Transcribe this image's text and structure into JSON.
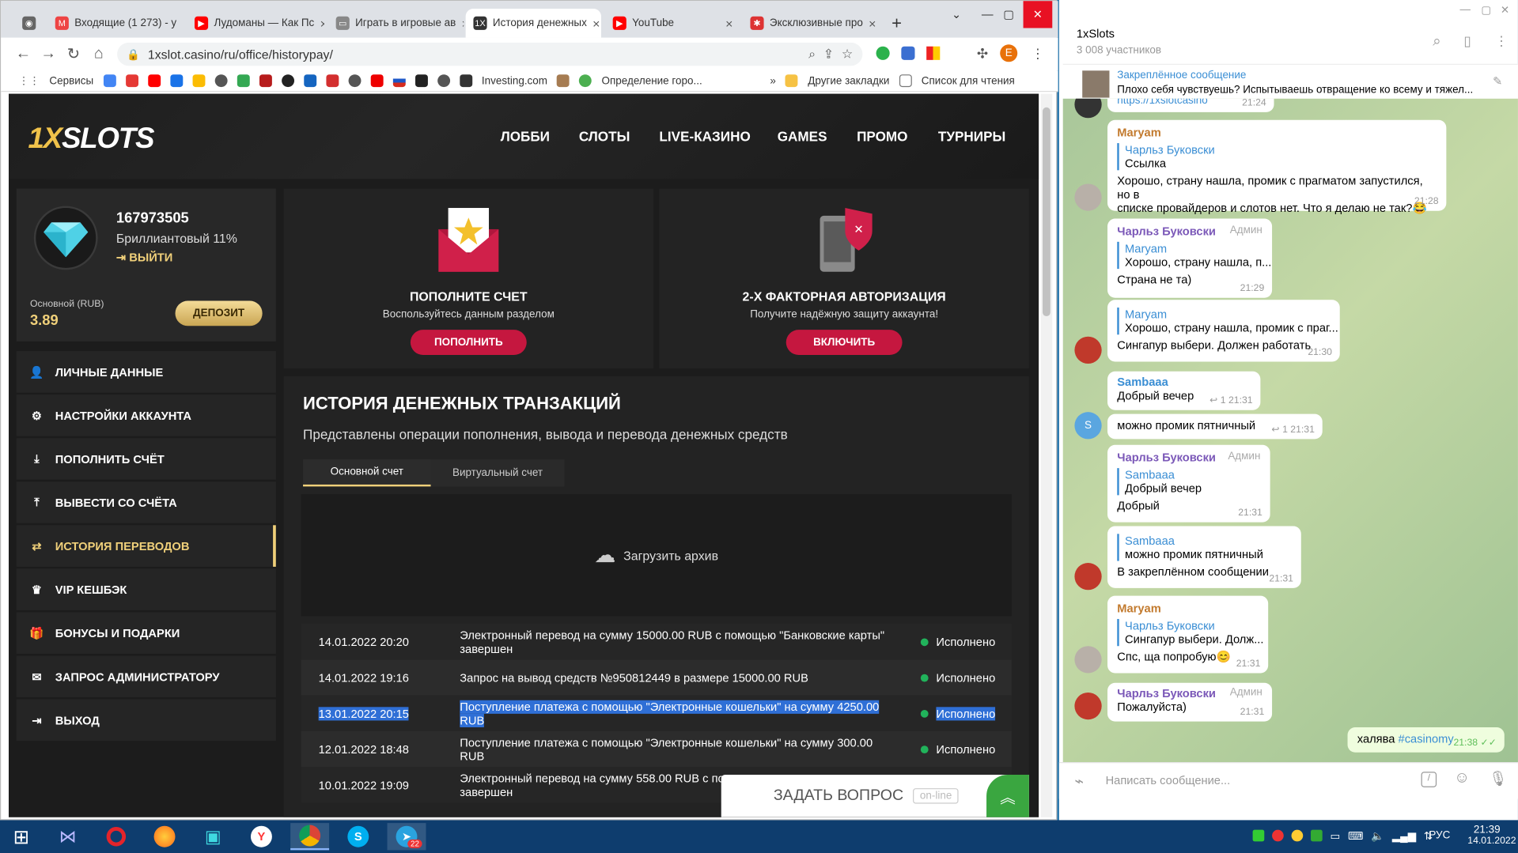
{
  "browser": {
    "tabs": [
      {
        "title": "Входящие (1 273) - у"
      },
      {
        "title": "Лудоманы — Как Пс"
      },
      {
        "title": "Играть в игровые ав"
      },
      {
        "title": "История денежных"
      },
      {
        "title": "YouTube"
      },
      {
        "title": "Эксклюзивные про"
      }
    ],
    "new_tab": "+",
    "url": "1xslot.casino/ru/office/historypay/",
    "profile_initial": "E",
    "bookmarks": {
      "services": "Сервисы",
      "investing": "Investing.com",
      "geo": "Определение горо...",
      "more": "»",
      "other": "Другие закладки",
      "reading": "Список для чтения"
    }
  },
  "site": {
    "logo": {
      "prefix": "1X",
      "suffix": "SLOTS"
    },
    "nav": [
      "ЛОББИ",
      "СЛОТЫ",
      "LIVE-КАЗИНО",
      "GAMES",
      "ПРОМО",
      "ТУРНИРЫ"
    ],
    "profile": {
      "id": "167973505",
      "level": "Бриллиантовый 11%",
      "logout": "ВЫЙТИ",
      "balance_label": "Основной (RUB)",
      "balance": "3.89",
      "deposit": "ДЕПОЗИТ"
    },
    "menu": [
      {
        "label": "ЛИЧНЫЕ ДАННЫЕ",
        "icon": "user-icon"
      },
      {
        "label": "НАСТРОЙКИ АККАУНТА",
        "icon": "settings-icon"
      },
      {
        "label": "ПОПОЛНИТЬ СЧЁТ",
        "icon": "download-icon"
      },
      {
        "label": "ВЫВЕСТИ СО СЧЁТА",
        "icon": "upload-icon"
      },
      {
        "label": "ИСТОРИЯ ПЕРЕВОДОВ",
        "icon": "transfer-icon"
      },
      {
        "label": "VIP КЕШБЭК",
        "icon": "crown-icon"
      },
      {
        "label": "БОНУСЫ И ПОДАРКИ",
        "icon": "gift-icon"
      },
      {
        "label": "ЗАПРОС АДМИНИСТРАТОРУ",
        "icon": "mail-icon"
      },
      {
        "label": "ВЫХОД",
        "icon": "exit-icon"
      }
    ],
    "cards": [
      {
        "title": "ПОПОЛНИТЕ СЧЕТ",
        "desc": "Воспользуйтесь данным разделом",
        "button": "ПОПОЛНИТЬ"
      },
      {
        "title": "2-Х ФАКТОРНАЯ АВТОРИЗАЦИЯ",
        "desc": "Получите надёжную защиту аккаунта!",
        "button": "ВКЛЮЧИТЬ"
      }
    ],
    "history": {
      "title": "ИСТОРИЯ ДЕНЕЖНЫХ ТРАНЗАКЦИЙ",
      "subtitle": "Представлены операции пополнения, вывода и перевода денежных средств",
      "tabs": [
        "Основной счет",
        "Виртуальный счет"
      ],
      "archive": "Загрузить архив",
      "rows": [
        {
          "date": "14.01.2022 20:20",
          "text": "Электронный перевод на сумму 15000.00 RUB с помощью \"Банковские карты\" завершен",
          "status": "Исполнено"
        },
        {
          "date": "14.01.2022 19:16",
          "text": "Запрос на вывод средств №950812449 в размере 15000.00 RUB",
          "status": "Исполнено"
        },
        {
          "date": "13.01.2022 20:15",
          "text": "Поступление платежа с помощью \"Электронные кошельки\" на сумму 4250.00 RUB",
          "status": "Исполнено"
        },
        {
          "date": "12.01.2022 18:48",
          "text": "Поступление платежа с помощью \"Электронные кошельки\" на сумму 300.00 RUB",
          "status": "Исполнено"
        },
        {
          "date": "10.01.2022 19:09",
          "text": "Электронный перевод на сумму 558.00 RUB с пом",
          "text2": "завершен",
          "status": ""
        }
      ]
    },
    "chat_widget": {
      "label": "ЗАДАТЬ ВОПРОС",
      "status": "on-line"
    }
  },
  "telegram": {
    "title": "1xSlots",
    "members": "3 008 участников",
    "pinned_label": "Закреплённое сообщение",
    "pinned_text": "Плохо себя чувствуешь? Испытываешь отвращение ко всему и тяжел...",
    "top_link": "https://1xslotcasino",
    "top_time": "21:24",
    "messages": [
      {
        "name": "Maryam",
        "quote_name": "Чарльз Буковски",
        "quote": "Ссылка",
        "text": "Хорошо, страну нашла, промик с прагматом запустился, но в",
        "text2": "списке провайдеров и слотов нет. Что я делаю не так?😂",
        "time": "21:28"
      },
      {
        "name": "Чарльз Буковски",
        "role": "Админ",
        "quote_name": "Maryam",
        "quote": "Хорошо, страну нашла, п...",
        "text": "Страна не та)",
        "time": "21:29"
      },
      {
        "quote_name": "Maryam",
        "quote": "Хорошо, страну нашла, промик с праг...",
        "text": "Сингапур выбери. Должен работать",
        "time": "21:30"
      },
      {
        "name": "Sambaaa",
        "text": "Добрый вечер",
        "replies": "1",
        "time": "21:31"
      },
      {
        "text": "можно промик пятничный",
        "replies": "1",
        "time": "21:31",
        "avatar": "S"
      },
      {
        "name": "Чарльз Буковски",
        "role": "Админ",
        "quote_name": "Sambaaa",
        "quote": "Добрый вечер",
        "text": "Добрый",
        "time": "21:31"
      },
      {
        "quote_name": "Sambaaa",
        "quote": "можно промик пятничный",
        "text": "В закреплённом сообщении",
        "time": "21:31"
      },
      {
        "name": "Maryam",
        "quote_name": "Чарльз Буковски",
        "quote": "Сингапур выбери. Долж...",
        "text": "Спс, ща попробую😊",
        "time": "21:31"
      },
      {
        "name": "Чарльз Буковски",
        "role": "Админ",
        "text": "Пожалуйста)",
        "time": "21:31"
      },
      {
        "text": "халява",
        "tag": "#casinomy",
        "time": "21:38"
      }
    ],
    "input_placeholder": "Написать сообщение..."
  },
  "taskbar": {
    "lang": "РУС",
    "time": "21:39",
    "date": "14.01.2022",
    "tg_badge": "22"
  },
  "colors": {
    "accent_red": "#c5173f",
    "gold": "#f0d07a",
    "status_green": "#21b35b",
    "tg_link": "#3a8ed4"
  }
}
